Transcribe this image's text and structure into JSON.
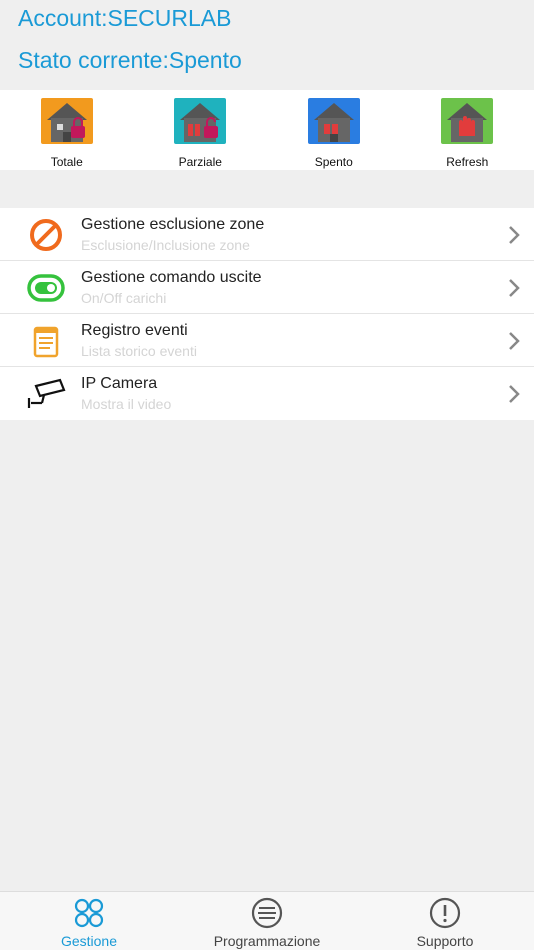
{
  "header": {
    "account": "Account:SECURLAB",
    "status": "Stato corrente:Spento"
  },
  "modes": [
    {
      "label": "Totale",
      "icon": "house-lock-totale-icon",
      "color": "#f29a1e"
    },
    {
      "label": "Parziale",
      "icon": "house-lock-parziale-icon",
      "color": "#1fb2be"
    },
    {
      "label": "Spento",
      "icon": "house-unlock-spento-icon",
      "color": "#2a7de1"
    },
    {
      "label": "Refresh",
      "icon": "house-hand-refresh-icon",
      "color": "#6cc24a"
    }
  ],
  "menu": [
    {
      "title": "Gestione esclusione zone",
      "subtitle": "Esclusione/Inclusione zone",
      "icon": "block-icon",
      "color": "#f06a1d"
    },
    {
      "title": "Gestione comando uscite",
      "subtitle": "On/Off carichi",
      "icon": "toggle-icon",
      "color": "#35c23d"
    },
    {
      "title": "Registro eventi",
      "subtitle": "Lista storico eventi",
      "icon": "notepad-icon",
      "color": "#f0a32c"
    },
    {
      "title": "IP Camera",
      "subtitle": "Mostra il video",
      "icon": "camera-icon",
      "color": "#111111"
    }
  ],
  "tabs": [
    {
      "label": "Gestione",
      "icon": "grid-circles-icon",
      "active": true
    },
    {
      "label": "Programmazione",
      "icon": "list-circle-icon",
      "active": false
    },
    {
      "label": "Supporto",
      "icon": "exclamation-circle-icon",
      "active": false
    }
  ],
  "colors": {
    "accent": "#1a9ad6",
    "background": "#efefef"
  }
}
